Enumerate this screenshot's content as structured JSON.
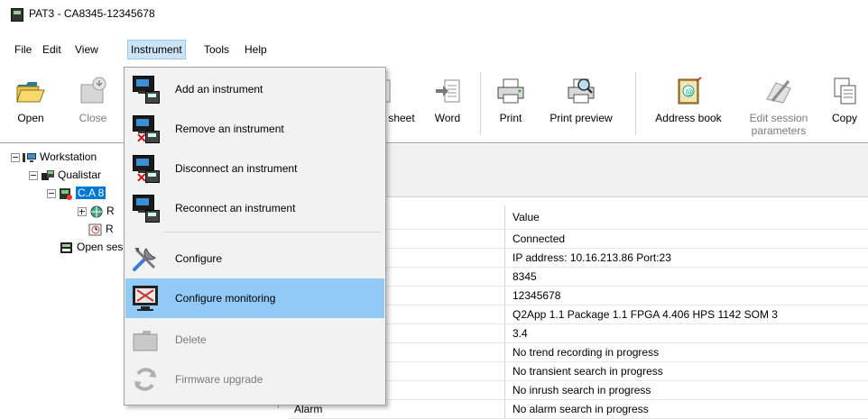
{
  "window": {
    "title": "PAT3 - CA8345-12345678"
  },
  "menubar": {
    "items": [
      "File",
      "Edit",
      "View",
      "Instrument",
      "Tools",
      "Help"
    ]
  },
  "toolbar": {
    "open": "Open",
    "close": "Close",
    "spreadsheet": "sheet",
    "word": "Word",
    "print": "Print",
    "print_preview": "Print preview",
    "address_book": "Address book",
    "edit_session_line1": "Edit session",
    "edit_session_line2": "parameters",
    "copy": "Copy"
  },
  "tree": {
    "workstation": "Workstation",
    "qualistar": "Qualistar",
    "instrument": "C.A 8",
    "child1": "R",
    "child2": "R",
    "open_session": "Open ses"
  },
  "grid": {
    "header_value": "Value",
    "rows": [
      {
        "label": "s",
        "value": "Connected"
      },
      {
        "label": "",
        "value": "IP address: 10.16.213.86 Port:23"
      },
      {
        "label": "",
        "value": "8345"
      },
      {
        "label": "number",
        "value": "12345678"
      },
      {
        "label": "",
        "value": "Q2App 1.1 Package 1.1 FPGA 4.406 HPS 1142 SOM 3"
      },
      {
        "label": "",
        "value": "3.4"
      },
      {
        "label": "",
        "value": "No trend recording in progress"
      },
      {
        "label": "",
        "value": "No transient search in progress"
      },
      {
        "label": "",
        "value": "No inrush search in progress"
      },
      {
        "label": "Alarm",
        "value": "No alarm search in progress"
      }
    ]
  },
  "instrument_menu": {
    "add": "Add an instrument",
    "remove": "Remove an instrument",
    "disconnect": "Disconnect an instrument",
    "reconnect": "Reconnect an instrument",
    "configure": "Configure",
    "configure_monitoring": "Configure monitoring",
    "delete": "Delete",
    "firmware_upgrade": "Firmware upgrade"
  }
}
